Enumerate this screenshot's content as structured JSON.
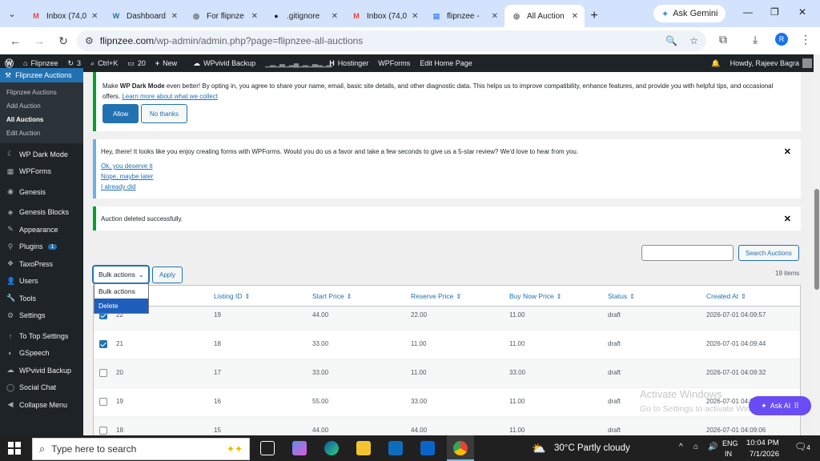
{
  "browser": {
    "tabs": [
      {
        "label": "Inbox (74,0",
        "icon": "gmail-icon",
        "color": "#ea4335"
      },
      {
        "label": "Dashboard",
        "icon": "wordpress-icon",
        "color": "#21759b"
      },
      {
        "label": "For flipnze",
        "icon": "globe-icon",
        "color": "#444444"
      },
      {
        "label": ".gitignore",
        "icon": "github-icon",
        "color": "#1f1f1f"
      },
      {
        "label": "Inbox (74,0",
        "icon": "gmail-icon",
        "color": "#ea4335"
      },
      {
        "label": "flipnzee -",
        "icon": "docs-icon",
        "color": "#4285f4"
      },
      {
        "label": "All Auction",
        "icon": "globe-icon",
        "color": "#444444"
      }
    ],
    "gemini_label": "Ask Gemini",
    "url_host": "flipnzee.com",
    "url_path": "/wp-admin/admin.php?page=flipnzee-all-auctions"
  },
  "adminbar": {
    "site": "Flipnzee",
    "updates": "3",
    "search": "Ctrl+K",
    "comments": "20",
    "new": "New",
    "wpvivid": "WPvivid Backup",
    "hostinger": "Hostinger",
    "wpforms": "WPForms",
    "edit_home": "Edit Home Page",
    "howdy": "Howdy, Rajeev Bagra"
  },
  "sidebar": {
    "active": "Flipnzee Auctions",
    "submenu": [
      "Flipnzee Auctions",
      "Add Auction",
      "All Auctions",
      "Edit Auction"
    ],
    "items": [
      {
        "label": "WP Dark Mode",
        "icon": "moon-icon"
      },
      {
        "label": "WPForms",
        "icon": "forms-icon"
      },
      {
        "label": "Genesis",
        "icon": "genesis-icon"
      },
      {
        "label": "Genesis Blocks",
        "icon": "blocks-icon"
      },
      {
        "label": "Appearance",
        "icon": "brush-icon"
      },
      {
        "label": "Plugins",
        "icon": "plug-icon",
        "badge": "1"
      },
      {
        "label": "TaxoPress",
        "icon": "tag-icon"
      },
      {
        "label": "Users",
        "icon": "user-icon"
      },
      {
        "label": "Tools",
        "icon": "wrench-icon"
      },
      {
        "label": "Settings",
        "icon": "settings-icon"
      },
      {
        "label": "To Top Settings",
        "icon": "arrow-up-icon"
      },
      {
        "label": "GSpeech",
        "icon": "speech-icon"
      },
      {
        "label": "WPvivid Backup",
        "icon": "cloud-icon"
      },
      {
        "label": "Social Chat",
        "icon": "chat-icon"
      },
      {
        "label": "Collapse Menu",
        "icon": "collapse-icon"
      }
    ]
  },
  "notice_darkmode": {
    "pre": "Make ",
    "bold": "WP Dark Mode",
    "text": " even better! By opting in, you agree to share your name, email, basic site details, and other diagnostic data. This helps us to improve compatibility, enhance features, and provide you with helpful tips, and occasional offers. ",
    "link": "Learn more about what we collect",
    "allow": "Allow",
    "no_thanks": "No thanks"
  },
  "notice_wpforms": {
    "text": "Hey, there! It looks like you enjoy creating forms with WPForms. Would you do us a favor and take a few seconds to give us a 5-star review? We'd love to hear from you.",
    "links": [
      "Ok, you deserve it",
      "Nope, maybe later",
      "I already did"
    ]
  },
  "notice_success": {
    "text": "Auction deleted successfully."
  },
  "toolbar": {
    "search_button": "Search Auctions",
    "bulk_label": "Bulk actions",
    "apply": "Apply",
    "count": "19 items",
    "bulk_options": [
      "Bulk actions",
      "Delete"
    ]
  },
  "table": {
    "headers": [
      "Listing ID",
      "Start Price",
      "Reserve Price",
      "Buy Now Price",
      "Status",
      "Created At"
    ],
    "rows": [
      {
        "id": "22",
        "listing": "19",
        "start": "44.00",
        "reserve": "22.00",
        "buy": "11.00",
        "status": "draft",
        "created": "2026-07-01 04:09:57",
        "checked": true
      },
      {
        "id": "21",
        "listing": "18",
        "start": "33.00",
        "reserve": "11.00",
        "buy": "11.00",
        "status": "draft",
        "created": "2026-07-01 04:09:44",
        "checked": true
      },
      {
        "id": "20",
        "listing": "17",
        "start": "33.00",
        "reserve": "11.00",
        "buy": "33.00",
        "status": "draft",
        "created": "2026-07-01 04:09:32",
        "checked": false
      },
      {
        "id": "19",
        "listing": "16",
        "start": "55.00",
        "reserve": "33.00",
        "buy": "11.00",
        "status": "draft",
        "created": "2026-07-01 04:09:19",
        "checked": false
      },
      {
        "id": "18",
        "listing": "15",
        "start": "44.00",
        "reserve": "44.00",
        "buy": "11.00",
        "status": "draft",
        "created": "2026-07-01 04:09:06",
        "checked": false
      }
    ]
  },
  "watermark": {
    "title": "Activate Windows",
    "sub": "Go to Settings to activate Windows."
  },
  "askai": "Ask AI",
  "taskbar": {
    "search_placeholder": "Type here to search",
    "weather": "30°C  Partly cloudy",
    "lang": "ENG",
    "region": "IN",
    "time": "10:04 PM",
    "date": "7/1/2026",
    "notif_count": "4"
  }
}
